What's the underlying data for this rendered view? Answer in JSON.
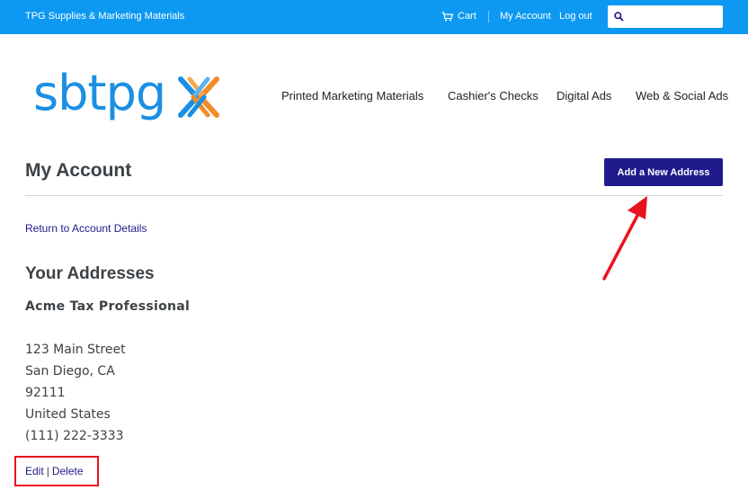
{
  "topbar": {
    "store_name": "TPG Supplies & Marketing Materials",
    "cart_label": "Cart",
    "account_label": "My Account",
    "logout_label": "Log out",
    "search": {
      "value": "",
      "placeholder": ""
    }
  },
  "logo": {
    "text": "sbtpg",
    "brand_blue": "#1b8fe3",
    "brand_orange": "#f28c28"
  },
  "nav": {
    "items": [
      {
        "label": "Printed Marketing Materials"
      },
      {
        "label": "Cashier's Checks"
      },
      {
        "label": "Digital Ads"
      },
      {
        "label": "Web & Social Ads"
      }
    ]
  },
  "main": {
    "title": "My Account",
    "add_address_label": "Add a New Address",
    "return_link": "Return to Account Details",
    "addresses_title": "Your Addresses",
    "address": {
      "name": "Acme Tax Professional",
      "street": "123 Main Street",
      "city_state": "San Diego, CA",
      "zip": "92111",
      "country": "United States",
      "phone": "(111) 222-3333"
    },
    "edit_label": "Edit",
    "delete_label": "Delete",
    "divider": "|"
  },
  "colors": {
    "topbar": "#0d99f2",
    "primary_button": "#1f1a8c",
    "annotation_red": "#e8131f"
  }
}
